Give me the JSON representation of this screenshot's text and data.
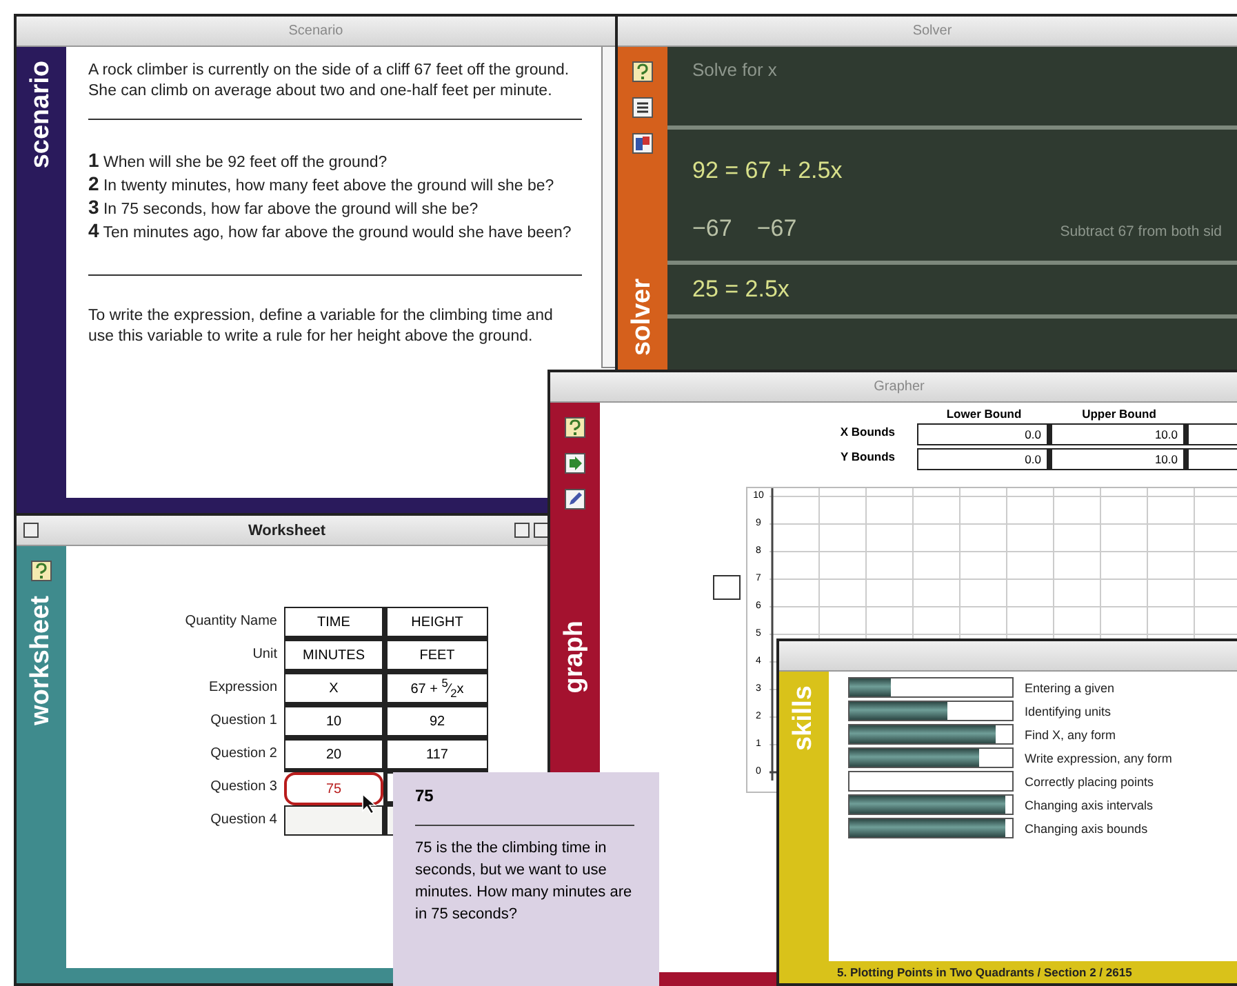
{
  "scenario": {
    "title": "Scenario",
    "label": "scenario",
    "intro": "A rock climber is currently on the side of a cliff 67 feet off the ground. She can climb on average about two and one-half feet per minute.",
    "questions": [
      {
        "number": "1",
        "text": "When will she be 92 feet off the ground?"
      },
      {
        "number": "2",
        "text": "In twenty minutes, how many feet above the ground will she be?"
      },
      {
        "number": "3",
        "text": "In 75 seconds, how far above the ground will she be?"
      },
      {
        "number": "4",
        "text": "Ten minutes ago, how far above the ground would she have been?"
      }
    ],
    "hint": "To write the expression, define a variable for the climbing time and use this variable to write a rule for her height above the ground."
  },
  "solver": {
    "title": "Solver",
    "label": "solver",
    "prompt": "Solve for x",
    "steps": [
      {
        "kind": "equation",
        "text": "92 = 67 + 2.5x"
      },
      {
        "kind": "operation",
        "left": "−67",
        "right": "−67",
        "note": "Subtract 67 from both sid"
      },
      {
        "kind": "equation",
        "text": "25 = 2.5x"
      }
    ]
  },
  "worksheet": {
    "title": "Worksheet",
    "label": "worksheet",
    "rows": [
      {
        "label": "Quantity Name",
        "cells": [
          {
            "value": "TIME",
            "error": false
          },
          {
            "value": "HEIGHT",
            "error": false
          }
        ]
      },
      {
        "label": "Unit",
        "cells": [
          {
            "value": "MINUTES",
            "error": false
          },
          {
            "value": "FEET",
            "error": false
          }
        ]
      },
      {
        "label": "Expression",
        "cells": [
          {
            "value": "X",
            "error": false
          },
          {
            "value": "67 + $^{5}$⁄$_{2}$x",
            "error": false
          }
        ]
      },
      {
        "label": "Question 1",
        "cells": [
          {
            "value": "10",
            "error": false
          },
          {
            "value": "92",
            "error": false
          }
        ]
      },
      {
        "label": "Question 2",
        "cells": [
          {
            "value": "20",
            "error": false
          },
          {
            "value": "117",
            "error": false
          }
        ]
      },
      {
        "label": "Question 3",
        "cells": [
          {
            "value": "75",
            "error": true
          },
          {
            "error": false
          }
        ]
      },
      {
        "label": "Question 4",
        "cells": [
          {
            "error": false
          },
          {
            "error": false
          }
        ]
      }
    ]
  },
  "grapher": {
    "title": "Grapher",
    "label": "graph",
    "bound_columns": [
      "Lower Bound",
      "Upper Bound"
    ],
    "bounds": [
      {
        "label": "X Bounds",
        "values": [
          "0.0",
          "10.0"
        ]
      },
      {
        "label": "Y Bounds",
        "values": [
          "0.0",
          "10.0"
        ]
      }
    ],
    "y_ticks": [
      "10",
      "9",
      "8",
      "7",
      "6",
      "5",
      "4",
      "3",
      "2",
      "1",
      "0"
    ]
  },
  "skills": {
    "label": "skills",
    "items": [
      {
        "name": "Entering a given",
        "level": 0.25
      },
      {
        "name": "Identifying units",
        "level": 0.6
      },
      {
        "name": "Find X, any form",
        "level": 0.9
      },
      {
        "name": "Write expression, any form",
        "level": 0.8
      },
      {
        "name": "Correctly placing points",
        "level": 0
      },
      {
        "name": "Changing axis intervals",
        "level": 0.96
      },
      {
        "name": "Changing axis bounds",
        "level": 0.96
      }
    ],
    "footer": "5. Plotting Points in Two Quadrants / Section 2 / 2615"
  },
  "tooltip": {
    "title": "75",
    "text": "75 is the the climbing time in seconds, but we want to use minutes. How many minutes are in 75 seconds?"
  }
}
